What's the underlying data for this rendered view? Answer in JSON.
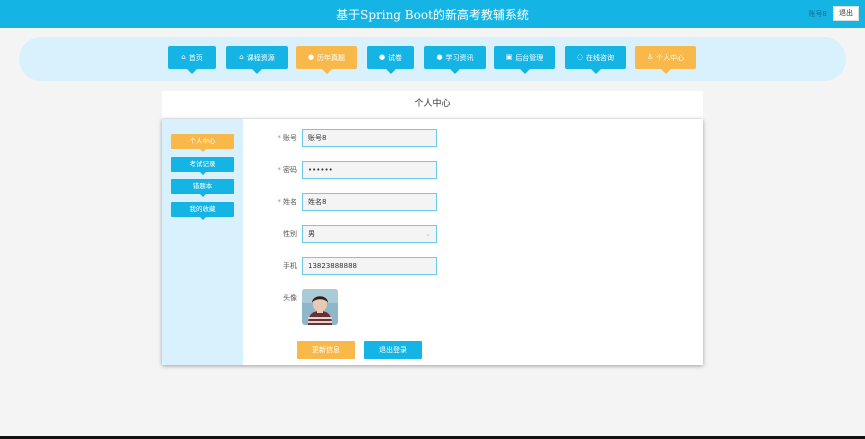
{
  "header": {
    "title": "基于Spring Boot的新高考教辅系统",
    "user": "账号8",
    "logout": "退出"
  },
  "nav": {
    "items": [
      {
        "label": "首页",
        "icon": "home-icon",
        "glyph": "⌂"
      },
      {
        "label": "课程资源",
        "icon": "bag-icon",
        "glyph": "⌂"
      },
      {
        "label": "历年真题",
        "icon": "info-icon",
        "glyph": "●"
      },
      {
        "label": "试卷",
        "icon": "question-icon",
        "glyph": "●"
      },
      {
        "label": "学习资讯",
        "icon": "info-icon",
        "glyph": "●"
      },
      {
        "label": "后台管理",
        "icon": "box-icon",
        "glyph": "▣"
      },
      {
        "label": "在线咨询",
        "icon": "chat-icon",
        "glyph": "◌"
      },
      {
        "label": "个人中心",
        "icon": "user-icon",
        "glyph": "♙"
      }
    ]
  },
  "page": {
    "title": "个人中心"
  },
  "sidebar": {
    "items": [
      {
        "label": "个人中心"
      },
      {
        "label": "考试记录"
      },
      {
        "label": "错题本"
      },
      {
        "label": "我的收藏"
      }
    ]
  },
  "form": {
    "account": {
      "label": "账号",
      "value": "账号8"
    },
    "password": {
      "label": "密码",
      "value": "••••••"
    },
    "name": {
      "label": "姓名",
      "value": "姓名8"
    },
    "gender": {
      "label": "性别",
      "value": "男"
    },
    "phone": {
      "label": "手机",
      "value": "13823888888"
    },
    "avatar": {
      "label": "头像"
    },
    "required_mark": "*"
  },
  "actions": {
    "update": "更新信息",
    "logout": "退出登录"
  },
  "colors": {
    "primary": "#14b4e4",
    "accent": "#f8b84a",
    "light": "#d9f1fc"
  }
}
